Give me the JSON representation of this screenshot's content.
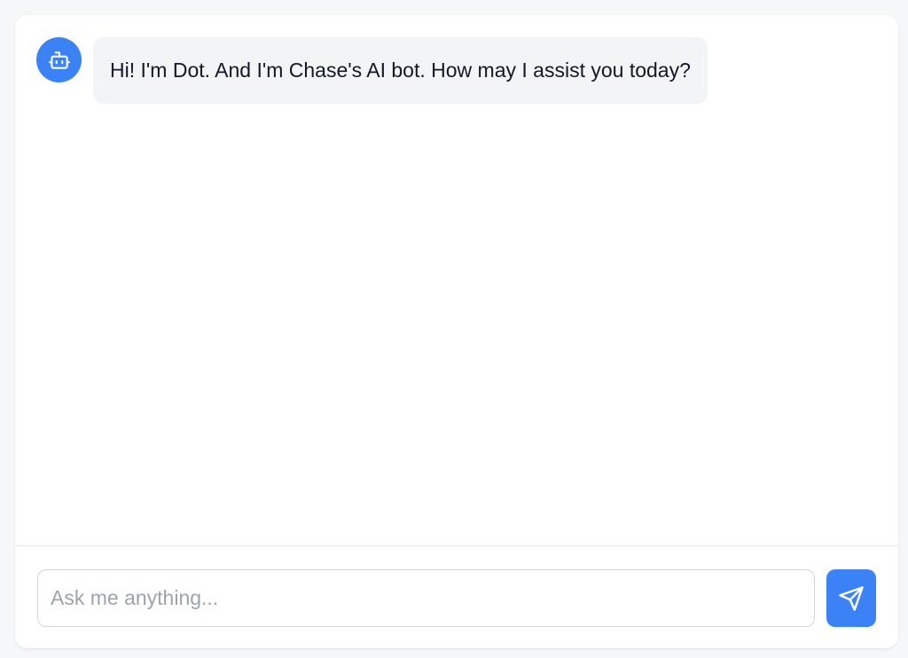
{
  "chat": {
    "messages": [
      {
        "sender": "bot",
        "avatar_icon": "robot-icon",
        "text": "Hi! I'm Dot. And I'm Chase's AI bot. How may I assist you today?"
      }
    ]
  },
  "composer": {
    "placeholder": "Ask me anything...",
    "value": "",
    "send_icon": "send-icon"
  },
  "colors": {
    "accent": "#3b82f6",
    "bubble_bg": "#f3f4f6",
    "page_bg": "#f6f7f9"
  }
}
